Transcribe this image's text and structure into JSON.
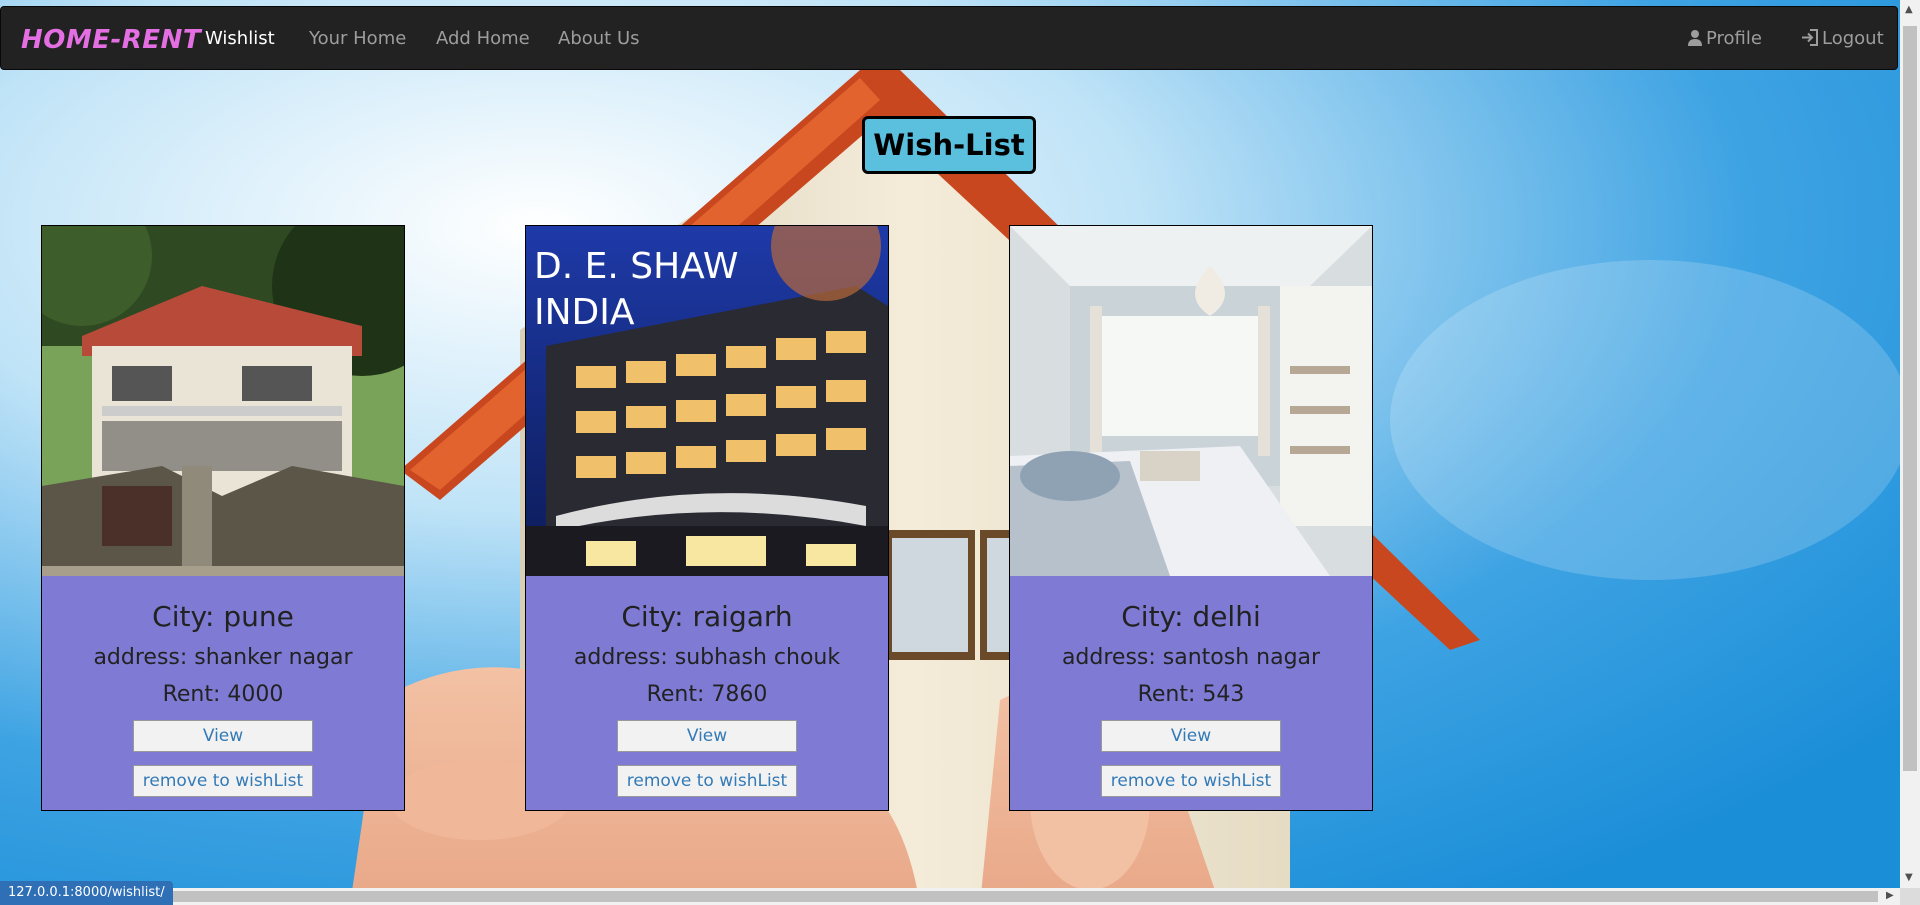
{
  "navbar": {
    "brand": "HOME-RENT",
    "links": [
      "Wishlist",
      "Your Home",
      "Add Home",
      "About Us"
    ],
    "active_link": "Wishlist",
    "profile_label": "Profile",
    "logout_label": "Logout"
  },
  "page": {
    "title": "Wish-List"
  },
  "cards": [
    {
      "photo_text": "",
      "city": "City: pune",
      "address": "address: shanker nagar",
      "rent": "Rent: 4000",
      "view_label": "View",
      "remove_label": "remove to wishList"
    },
    {
      "photo_text": "D. E. SHAW INDIA",
      "photo_line1": "D. E. SHAW",
      "photo_line2": "INDIA",
      "city": "City: raigarh",
      "address": "address: subhash chouk",
      "rent": "Rent: 7860",
      "view_label": "View",
      "remove_label": "remove to wishList"
    },
    {
      "photo_text": "",
      "city": "City: delhi",
      "address": "address: santosh nagar",
      "rent": "Rent: 543",
      "view_label": "View",
      "remove_label": "remove to wishList"
    }
  ],
  "status_bar": {
    "url": "127.0.0.1:8000/wishlist/"
  },
  "colors": {
    "navbar_bg": "#222222",
    "brand": "#e46fe3",
    "title_badge": "#5bc0de",
    "card_bg": "#7f7bd5",
    "button_text": "#337ab7",
    "status_bar": "#2e6fb6"
  },
  "icons": {
    "profile": "user-icon",
    "logout": "log-in-icon"
  }
}
